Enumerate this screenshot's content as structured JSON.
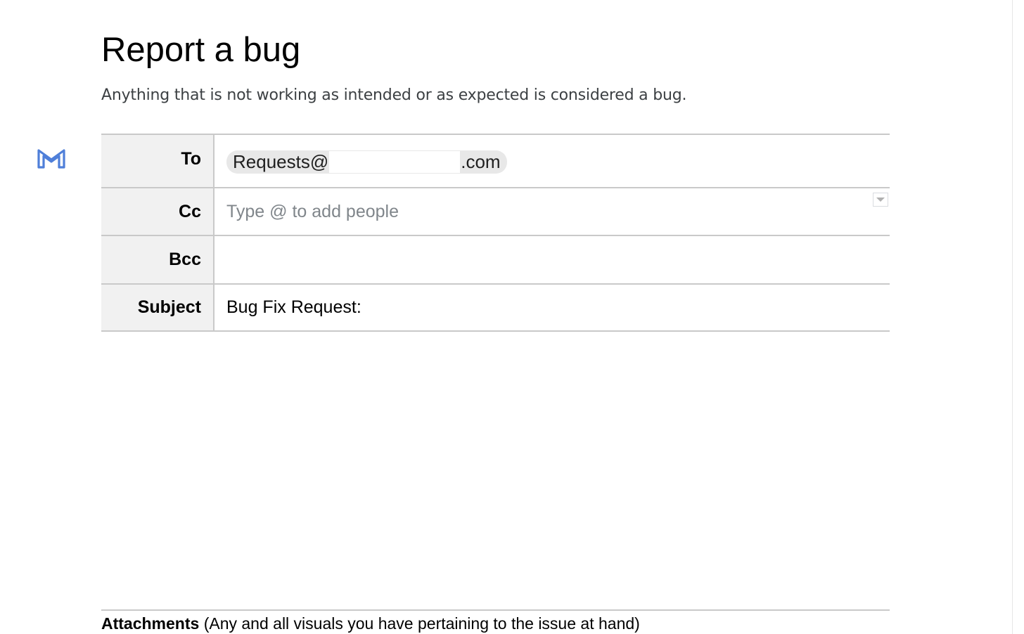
{
  "header": {
    "title": "Report a bug",
    "subtitle": "Anything that is not working as intended or as expected is considered a bug."
  },
  "email_draft": {
    "icon": "gmail-icon",
    "to": {
      "label": "To",
      "recipient_prefix": "Requests@",
      "recipient_suffix": ".com"
    },
    "cc": {
      "label": "Cc",
      "placeholder": "Type @ to add people"
    },
    "bcc": {
      "label": "Bcc",
      "value": ""
    },
    "subject": {
      "label": "Subject",
      "value": "Bug Fix Request:"
    }
  },
  "attachments": {
    "label": "Attachments",
    "note": "(Any and all visuals you have pertaining to the issue at hand)"
  },
  "colors": {
    "icon_blue": "#4f7fd9",
    "label_background": "#f1f1f1",
    "border": "#c9c9c9",
    "placeholder": "#80868b"
  }
}
